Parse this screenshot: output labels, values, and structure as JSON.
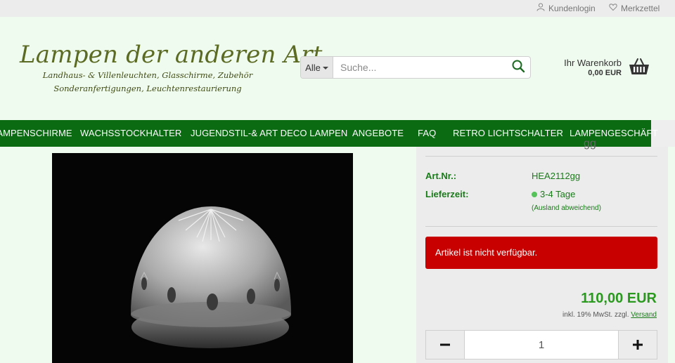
{
  "topbar": {
    "login_label": "Kundenlogin",
    "wishlist_label": "Merkzettel"
  },
  "header": {
    "logo_title": "Lampen der anderen Art",
    "logo_line1": "Landhaus- & Villenleuchten, Glasschirme, Zubehör",
    "logo_line2": "Sonderanfertigungen, Leuchtenrestaurierung"
  },
  "search": {
    "category": "Alle",
    "placeholder": "Suche..."
  },
  "cart": {
    "label": "Ihr Warenkorb",
    "total": "0,00 EUR"
  },
  "nav": {
    "items": [
      "LAMPENSCHIRME",
      "WACHSSTOCKHALTER",
      "JUGENDSTIL-& ART DECO LAMPEN",
      "ANGEBOTE",
      "FAQ",
      "RETRO LICHTSCHALTER",
      "LAMPENGESCHÄFT"
    ]
  },
  "product": {
    "title_fragment": "gg",
    "sku_label": "Art.Nr.:",
    "sku_value": "HEA2112gg",
    "delivery_label": "Lieferzeit:",
    "delivery_value": "3-4 Tage",
    "delivery_note": "(Ausland abweichend)",
    "availability_alert": "Artikel ist nicht verfügbar.",
    "price": "110,00 EUR",
    "tax_note": "inkl. 19% MwSt. zzgl.",
    "shipping_link": "Versand",
    "quantity": "1"
  },
  "colors": {
    "nav_bg": "#0a6b12",
    "page_bg": "#f0fbef",
    "alert_bg": "#c80000",
    "price": "#2a9a1f"
  }
}
